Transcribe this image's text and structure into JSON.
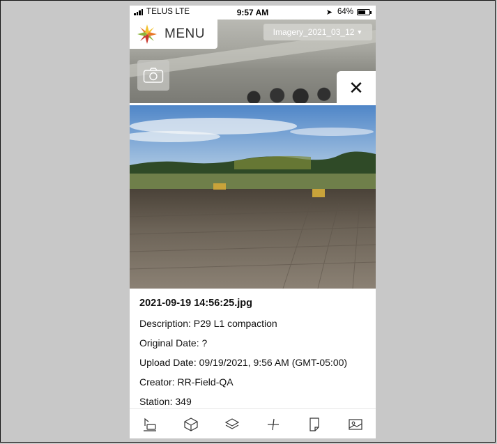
{
  "status_bar": {
    "carrier": "TELUS LTE",
    "time": "9:57 AM",
    "battery": "64%",
    "battery_level": 0.64
  },
  "menu": {
    "label": "MENU"
  },
  "imagery_layer": {
    "selected": "Imagery_2021_03_12"
  },
  "close_label": "✕",
  "photo_details": {
    "filename": "2021-09-19 14:56:25.jpg",
    "description": "Description: P29 L1 compaction",
    "original_date": "Original Date: ?",
    "upload_date": "Upload Date: 09/19/2021, 9:56 AM (GMT-05:00)",
    "creator": "Creator: RR-Field-QA",
    "station": "Station: 349"
  },
  "toolbar": {
    "items": [
      {
        "icon": "measure-tool-icon"
      },
      {
        "icon": "cube-icon"
      },
      {
        "icon": "layers-icon"
      },
      {
        "icon": "plus-crosshair-icon"
      },
      {
        "icon": "document-icon"
      },
      {
        "icon": "image-gallery-icon"
      }
    ]
  },
  "colors": {
    "logo_orange": "#e8782a",
    "logo_green": "#8cb43c",
    "logo_yellow": "#f2c12e",
    "logo_red": "#c9382f"
  }
}
